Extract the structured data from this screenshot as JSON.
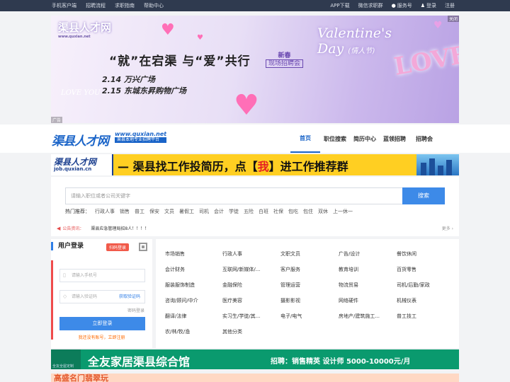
{
  "topbar": {
    "left": [
      "手机客户端",
      "招聘流程",
      "求职指南",
      "帮助中心"
    ],
    "right": [
      "APP下载",
      "微信求职群",
      "服务号",
      "登录",
      "注册"
    ]
  },
  "banner": {
    "logo": "渠县人才网",
    "logo_url": "www.quxian.net",
    "title": "“就”在宕渠  与“爱”共行",
    "newyear_top": "新春",
    "newyear_bottom": "现场招聘会",
    "line1": "2.14 万兴广场",
    "line2": "2.15 东城东昇购物广场",
    "valentine": "Valentine's",
    "day": "Day",
    "day_cn": "(情人节)",
    "love": "LOVE",
    "love_you": "LOVE YOU",
    "ad_tag": "广告",
    "close": "关闭"
  },
  "header": {
    "logo": "渠县人才网",
    "url": "www.quxian.net",
    "tagline": "渠县本地专业招聘平台",
    "nav": [
      "首页",
      "职位搜索",
      "简历中心",
      "蓝领招聘",
      "招聘会"
    ]
  },
  "ad2": {
    "logo_name": "渠县人才网",
    "logo_url": "job.quxian.cn",
    "text_before": "— 渠县找工作投简历，点【",
    "text_highlight": "我",
    "text_after": "】进工作推荐群"
  },
  "search": {
    "placeholder": "请输入职位或者公司关键字",
    "button": "搜索",
    "hot_label": "热门推荐：",
    "hot_words": [
      "行政人事",
      "销售",
      "普工",
      "保安",
      "文员",
      "暑假工",
      "司机",
      "会计",
      "学徒",
      "五险",
      "白班",
      "社保",
      "包吃",
      "包住",
      "双休",
      "上一休一"
    ],
    "notice_label": "公告资讯：",
    "notice_text": "渠县应急管理局招8人！！！！",
    "notice_more": "更多 ›"
  },
  "login": {
    "title": "用户登录",
    "scan": "扫码登录",
    "phone_placeholder": "请输入手机号",
    "code_placeholder": "请输入验证码",
    "get_code": "获取验证码",
    "pwd_link": "密码登录",
    "button": "立即登录",
    "register": "我还没有账号，立即注册"
  },
  "categories": [
    [
      "市场销售",
      "行政人事",
      "文职文员",
      "广告/设计",
      "餐饮休闲"
    ],
    [
      "会计财务",
      "互联网/新媒体/...",
      "客户服务",
      "教育培训",
      "百货零售"
    ],
    [
      "服装服饰制造",
      "金融保险",
      "管理运营",
      "物流贸易",
      "司机/后勤/家政"
    ],
    [
      "咨询/顾问/中介",
      "医疗美容",
      "摄影影视",
      "网络硬件",
      "机械仪表"
    ],
    [
      "翻译/法律",
      "实习生/学徒/其...",
      "电子/电气",
      "房地产/建筑施工...",
      "普工技工"
    ],
    [
      "农/林/牧/渔",
      "其他分类"
    ]
  ],
  "ad3": {
    "logo": "全友全屋定制",
    "title": "全友家居渠县综合馆",
    "recruit": "招聘：销售精英 设计师   5000-10000元/月"
  },
  "ad4": {
    "text": "高盛名门翡翠玩"
  }
}
